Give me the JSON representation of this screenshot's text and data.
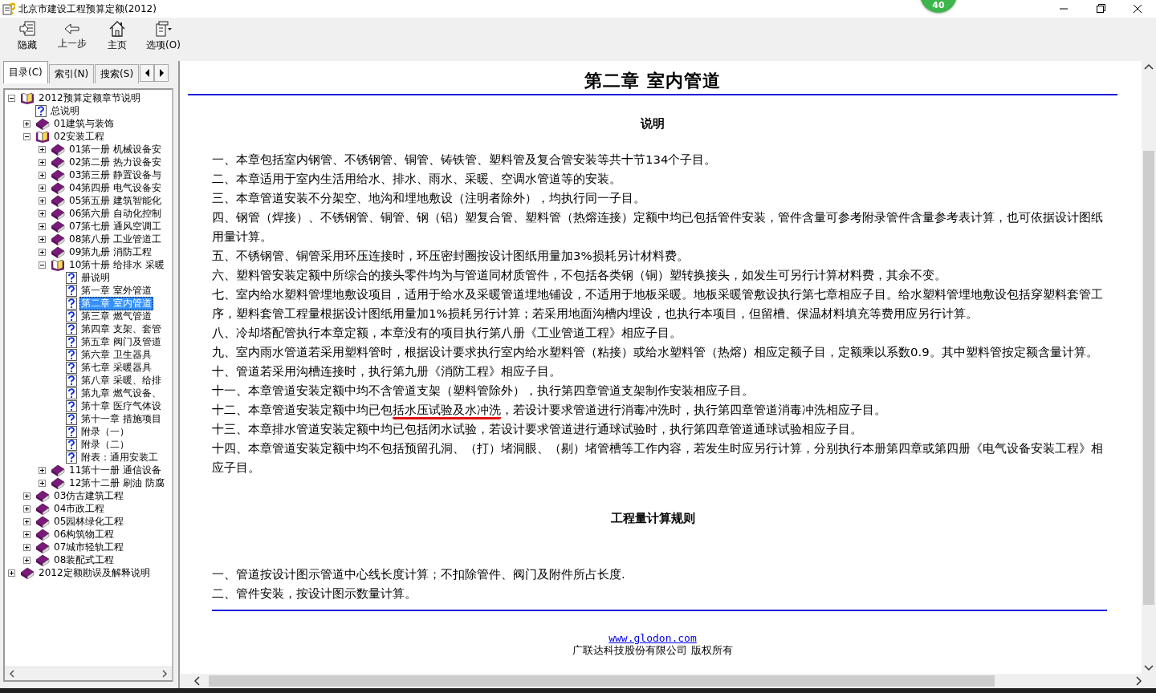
{
  "window": {
    "title": "北京市建设工程预算定额(2012)",
    "badge": "40"
  },
  "toolbar": [
    {
      "label": "隐藏",
      "kind": "hide"
    },
    {
      "label": "上一步",
      "kind": "back"
    },
    {
      "label": "主页",
      "kind": "home"
    },
    {
      "label": "选项(O)",
      "kind": "options"
    }
  ],
  "tabs": [
    {
      "label": "目录(C)",
      "selected": true
    },
    {
      "label": "索引(N)",
      "selected": false
    },
    {
      "label": "搜索(S)",
      "selected": false
    }
  ],
  "tree": [
    {
      "label": "2012预算定额章节说明",
      "kind": "book",
      "expanded": true,
      "selected": false,
      "children": [
        {
          "label": "总说明",
          "kind": "topic",
          "selected": false
        },
        {
          "label": "01建筑与装饰",
          "kind": "book",
          "expanded": false,
          "selected": false
        },
        {
          "label": "02安装工程",
          "kind": "book",
          "expanded": true,
          "selected": false,
          "children": [
            {
              "label": "01第一册 机械设备安",
              "kind": "book",
              "expanded": false,
              "selected": false
            },
            {
              "label": "02第二册 热力设备安",
              "kind": "book",
              "expanded": false,
              "selected": false
            },
            {
              "label": "03第三册 静置设备与",
              "kind": "book",
              "expanded": false,
              "selected": false
            },
            {
              "label": "04第四册 电气设备安",
              "kind": "book",
              "expanded": false,
              "selected": false
            },
            {
              "label": "05第五册 建筑智能化",
              "kind": "book",
              "expanded": false,
              "selected": false
            },
            {
              "label": "06第六册 自动化控制",
              "kind": "book",
              "expanded": false,
              "selected": false
            },
            {
              "label": "07第七册 通风空调工",
              "kind": "book",
              "expanded": false,
              "selected": false
            },
            {
              "label": "08第八册 工业管道工",
              "kind": "book",
              "expanded": false,
              "selected": false
            },
            {
              "label": "09第九册 消防工程",
              "kind": "book",
              "expanded": false,
              "selected": false
            },
            {
              "label": "10第十册 给排水 采暖",
              "kind": "book",
              "expanded": true,
              "selected": false,
              "children": [
                {
                  "label": "册说明",
                  "kind": "topic",
                  "selected": false
                },
                {
                  "label": "第一章 室外管道",
                  "kind": "topic",
                  "selected": false
                },
                {
                  "label": "第二章 室内管道",
                  "kind": "topic",
                  "selected": true
                },
                {
                  "label": "第三章 燃气管道",
                  "kind": "topic",
                  "selected": false
                },
                {
                  "label": "第四章 支架、套管",
                  "kind": "topic",
                  "selected": false
                },
                {
                  "label": "第五章 阀门及管道",
                  "kind": "topic",
                  "selected": false
                },
                {
                  "label": "第六章 卫生器具",
                  "kind": "topic",
                  "selected": false
                },
                {
                  "label": "第七章 采暖器具",
                  "kind": "topic",
                  "selected": false
                },
                {
                  "label": "第八章 采暖、给排",
                  "kind": "topic",
                  "selected": false
                },
                {
                  "label": "第九章 燃气设备、",
                  "kind": "topic",
                  "selected": false
                },
                {
                  "label": "第十章 医疗气体设",
                  "kind": "topic",
                  "selected": false
                },
                {
                  "label": "第十一章 措施项目",
                  "kind": "topic",
                  "selected": false
                },
                {
                  "label": "附录（一）",
                  "kind": "topic",
                  "selected": false
                },
                {
                  "label": "附录（二）",
                  "kind": "topic",
                  "selected": false
                },
                {
                  "label": "附表：通用安装工",
                  "kind": "topic",
                  "selected": false
                }
              ]
            },
            {
              "label": "11第十一册 通信设备",
              "kind": "book",
              "expanded": false,
              "selected": false
            },
            {
              "label": "12第十二册 刷油 防腐",
              "kind": "book",
              "expanded": false,
              "selected": false
            }
          ]
        },
        {
          "label": "03仿古建筑工程",
          "kind": "book",
          "expanded": false,
          "selected": false
        },
        {
          "label": "04市政工程",
          "kind": "book",
          "expanded": false,
          "selected": false
        },
        {
          "label": "05园林绿化工程",
          "kind": "book",
          "expanded": false,
          "selected": false
        },
        {
          "label": "06构筑物工程",
          "kind": "book",
          "expanded": false,
          "selected": false
        },
        {
          "label": "07城市轻轨工程",
          "kind": "book",
          "expanded": false,
          "selected": false
        },
        {
          "label": "08装配式工程",
          "kind": "book",
          "expanded": false,
          "selected": false
        }
      ]
    },
    {
      "label": "2012定额勘误及解释说明",
      "kind": "book",
      "expanded": false,
      "selected": false
    }
  ],
  "document": {
    "title": "第二章  室内管道",
    "sections": [
      {
        "heading": "说明",
        "paragraphs": [
          {
            "text": "一、本章包括室内钢管、不锈钢管、铜管、铸铁管、塑料管及复合管安装等共十节134个子目。"
          },
          {
            "text": "二、本章适用于室内生活用给水、排水、雨水、采暖、空调水管道等的安装。"
          },
          {
            "text": "三、本章管道安装不分架空、地沟和埋地敷设（注明者除外），均执行同一子目。"
          },
          {
            "text": "四、钢管（焊接）、不锈钢管、铜管、钢（铝）塑复合管、塑料管（热熔连接）定额中均已包括管件安装，管件含量可参考附录管件含量参考表计算，也可依据设计图纸用量计算。"
          },
          {
            "text": "五、不锈钢管、铜管采用环压连接时，环压密封圈按设计图纸用量加3%损耗另计材料费。"
          },
          {
            "text": "六、塑料管安装定额中所综合的接头零件均为与管道同材质管件，不包括各类钢（铜）塑转换接头，如发生可另行计算材料费，其余不变。"
          },
          {
            "text": "七、室内给水塑料管埋地敷设项目，适用于给水及采暖管道埋地铺设，不适用于地板采暖。地板采暖管敷设执行第七章相应子目。给水塑料管埋地敷设包括穿塑料套管工序，塑料套管工程量根据设计图纸用量加1%损耗另行计算；若采用地面沟槽内埋设，也执行本项目，但留槽、保温材料填充等费用应另行计算。"
          },
          {
            "text": "八、冷却塔配管执行本章定额，本章没有的项目执行第八册《工业管道工程》相应子目。"
          },
          {
            "text": "九、室内雨水管道若采用塑料管时，根据设计要求执行室内给水塑料管（粘接）或给水塑料管（热熔）相应定额子目，定额乘以系数0.9。其中塑料管按定额含量计算。"
          },
          {
            "text": "十、管道若采用沟槽连接时，执行第九册《消防工程》相应子目。"
          },
          {
            "text": "十一、本章管道安装定额中均不含管道支架（塑料管除外），执行第四章管道支架制作安装相应子目。"
          },
          {
            "text": "十二、本章管道安装定额中均已包",
            "marked": "括水压试验及水冲洗",
            "after": "，若设计要求管道进行消毒冲洗时，执行第四章管道消毒冲洗相应子目。"
          },
          {
            "text": "十三、本章排水管道安装定额中均已包括闭水试验，若设计要求管道进行通球试验时，执行第四章管道通球试验相应子目。"
          },
          {
            "text": "十四、本章管道安装定额中均不包括预留孔洞、（打）堵洞眼、（剔）堵管槽等工作内容，若发生时应另行计算，分别执行本册第四章或第四册《电气设备安装工程》相应子目。"
          }
        ]
      },
      {
        "heading": "工程量计算规则",
        "paragraphs": [
          {
            "text": "一、管道按设计图示管道中心线长度计算；不扣除管件、阀门及附件所占长度."
          },
          {
            "text": "二、管件安装，按设计图示数量计算。"
          }
        ]
      }
    ],
    "footer_link": "www.glodon.com",
    "footer_text": "广联达科技股份有限公司 版权所有"
  }
}
